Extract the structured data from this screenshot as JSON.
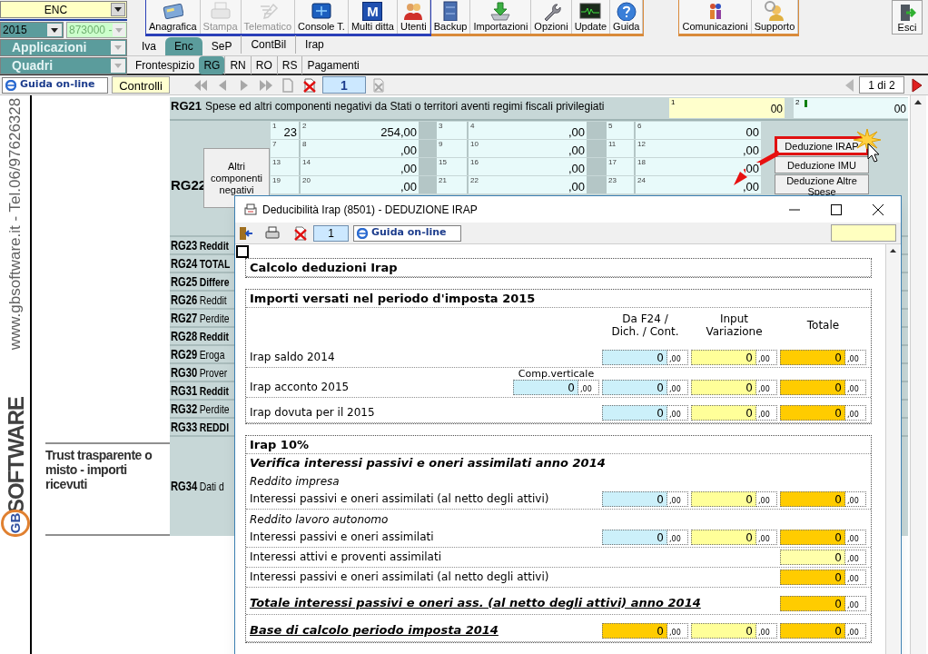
{
  "header": {
    "company": "ENC",
    "year": "2015",
    "code": "873000 -",
    "applicazioni": "Applicazioni",
    "quadri": "Quadri"
  },
  "toolbar_groups": [
    {
      "color": "#2a3fb8",
      "buttons": [
        {
          "label": "Anagrafica",
          "disabled": false
        },
        {
          "label": "Stampa",
          "disabled": true
        },
        {
          "label": "Telematico",
          "disabled": true
        },
        {
          "label": "Console T.",
          "disabled": false
        },
        {
          "label": "Multi ditta",
          "glyph": "M",
          "disabled": false
        },
        {
          "label": "Utenti",
          "disabled": false
        }
      ]
    },
    {
      "color": "#d98a3a",
      "buttons": [
        {
          "label": "Backup",
          "disabled": false
        },
        {
          "label": "Importazioni",
          "disabled": false
        },
        {
          "label": "Opzioni",
          "disabled": false
        },
        {
          "label": "Update",
          "disabled": false
        },
        {
          "label": "Guida",
          "disabled": false
        }
      ]
    },
    {
      "color": "#d98a3a",
      "buttons": [
        {
          "label": "Comunicazioni",
          "disabled": false
        },
        {
          "label": "Supporto",
          "disabled": false
        }
      ]
    }
  ],
  "exit_button": "Esci",
  "app_tabs": [
    {
      "label": "Iva",
      "selected": false
    },
    {
      "label": "Enc",
      "selected": true
    },
    {
      "label": "SeP",
      "selected": false
    },
    {
      "label": "ContBil",
      "selected": false
    },
    {
      "label": "Irap",
      "selected": false
    }
  ],
  "quadri_tabs": [
    {
      "label": "Frontespizio",
      "selected": false
    },
    {
      "label": "RG",
      "selected": true
    },
    {
      "label": "RN",
      "selected": false
    },
    {
      "label": "RO",
      "selected": false
    },
    {
      "label": "RS",
      "selected": false
    },
    {
      "label": "Pagamenti",
      "selected": false
    }
  ],
  "nav": {
    "help": "Guida on-line",
    "checks": "Controlli",
    "page": "1",
    "pages": "1 di 2"
  },
  "side": {
    "contact": "www.gbsoftware.it - Tel.06/97626328",
    "brand_mark": "GB",
    "brand": "SOFTWARE",
    "note": "Trust trasparente o misto - importi ricevuti"
  },
  "form": {
    "rg21": {
      "code": "RG21",
      "label": "Spese ed altri componenti negativi da Stati o territori aventi regimi fiscali privilegiati",
      "fields": [
        {
          "number": "1",
          "value": "00",
          "color": "#ffffcc",
          "focused": false
        },
        {
          "number": "2",
          "value": "00",
          "color": "#eafafa",
          "focused": true
        }
      ]
    },
    "rg22": {
      "code": "RG22",
      "button": "Altri componenti negativi",
      "rows": [
        {
          "cells": [
            {
              "number": "1",
              "value": "23"
            },
            {
              "number": "2",
              "value": "254,00"
            },
            {
              "number": "3"
            },
            {
              "number": "4",
              "value": ",00"
            },
            {
              "number": "5"
            },
            {
              "number": "6",
              "value": "00"
            }
          ]
        },
        {
          "cells": [
            {
              "number": "7"
            },
            {
              "number": "8",
              "value": ",00"
            },
            {
              "number": "9"
            },
            {
              "number": "10",
              "value": ",00"
            },
            {
              "number": "11"
            },
            {
              "number": "12",
              "value": ",00"
            }
          ]
        },
        {
          "cells": [
            {
              "number": "13"
            },
            {
              "number": "14",
              "value": ",00"
            },
            {
              "number": "15"
            },
            {
              "number": "16",
              "value": ",00"
            },
            {
              "number": "17"
            },
            {
              "number": "18",
              "value": "00"
            }
          ]
        },
        {
          "cells": [
            {
              "number": "19"
            },
            {
              "number": "20",
              "value": ",00"
            },
            {
              "number": "21"
            },
            {
              "number": "22",
              "value": ",00"
            },
            {
              "number": "23"
            },
            {
              "number": "24",
              "value": ",00"
            }
          ]
        }
      ]
    },
    "actions": [
      {
        "label": "Deduzione IRAP",
        "highlighted": true
      },
      {
        "label": "Deduzione IMU",
        "highlighted": false
      },
      {
        "label": "Deduzione Altre Spese",
        "highlighted": false
      }
    ],
    "lines": [
      {
        "code": "RG23",
        "label": "Reddit",
        "bold": true
      },
      {
        "code": "RG24",
        "label": "TOTAL",
        "bold": true
      },
      {
        "code": "RG25",
        "label": "Differe",
        "bold": true
      },
      {
        "code": "RG26",
        "label": "Reddit",
        "bold": false
      },
      {
        "code": "RG27",
        "label": "Perdite",
        "bold": false
      },
      {
        "code": "RG28",
        "label": "Reddit",
        "bold": true
      },
      {
        "code": "RG29",
        "label": "Eroga",
        "bold": false
      },
      {
        "code": "RG30",
        "label": "Prover",
        "bold": false
      },
      {
        "code": "RG31",
        "label": "Reddit",
        "bold": true
      },
      {
        "code": "RG32",
        "label": "Perdite",
        "bold": false
      },
      {
        "code": "RG33",
        "label": "REDDI",
        "bold": true
      }
    ],
    "rg34": {
      "code": "RG34",
      "label": "Dati d"
    }
  },
  "dialog": {
    "title": "Deducibilità Irap (8501) - DEDUZIONE IRAP",
    "page": "1",
    "help": "Guida on-line",
    "columns": [
      "Da F24 /\nDich. / Cont.",
      "Input\nVariazione",
      "Totale"
    ],
    "sections": [
      {
        "title": "Calcolo deduzioni Irap"
      },
      {
        "title": "Importi versati nel periodo d'imposta 2015",
        "show_columns": true,
        "rows": [
          {
            "kind": "values",
            "label": "Irap saldo 2014",
            "f24": {
              "value": "0",
              "decimals": ",00",
              "color": "#ccf0fa"
            },
            "variazione": {
              "value": "0",
              "decimals": ",00",
              "color": "#ffff99"
            },
            "totale": {
              "value": "0",
              "decimals": ",00",
              "color": "#ffcc00"
            }
          },
          {
            "kind": "values",
            "label": "Irap acconto 2015",
            "extra": {
              "label": "Comp.verticale",
              "value": "0",
              "decimals": ",00",
              "color": "#ccf0fa"
            },
            "f24": {
              "value": "0",
              "decimals": ",00",
              "color": "#ccf0fa"
            },
            "variazione": {
              "value": "0",
              "decimals": ",00",
              "color": "#ffff99"
            },
            "totale": {
              "value": "0",
              "decimals": ",00",
              "color": "#ffcc00"
            }
          },
          {
            "kind": "values",
            "label": "Irap dovuta per il 2015",
            "f24": {
              "value": "0",
              "decimals": ",00",
              "color": "#ccf0fa"
            },
            "variazione": {
              "value": "0",
              "decimals": ",00",
              "color": "#ffff99"
            },
            "totale": {
              "value": "0",
              "decimals": ",00",
              "color": "#ffcc00"
            }
          }
        ]
      },
      {
        "title": "Irap 10%",
        "rows": [
          {
            "kind": "heading",
            "label": "Verifica interessi passivi e oneri assimilati anno 2014"
          },
          {
            "kind": "note",
            "label": "Reddito impresa"
          },
          {
            "kind": "values",
            "label": "Interessi passivi e oneri assimilati (al netto degli attivi)",
            "f24": {
              "value": "0",
              "decimals": ",00",
              "color": "#ccf0fa"
            },
            "variazione": {
              "value": "0",
              "decimals": ",00",
              "color": "#ffff99"
            },
            "totale": {
              "value": "0",
              "decimals": ",00",
              "color": "#ffcc00"
            }
          },
          {
            "kind": "note",
            "label": "Reddito lavoro autonomo"
          },
          {
            "kind": "values",
            "label": "Interessi passivi e oneri assimilati",
            "f24": {
              "value": "0",
              "decimals": ",00",
              "color": "#ccf0fa"
            },
            "variazione": {
              "value": "0",
              "decimals": ",00",
              "color": "#ffff99"
            },
            "totale": {
              "value": "0",
              "decimals": ",00",
              "color": "#ffcc00"
            }
          },
          {
            "kind": "values",
            "label": "Interessi attivi e proventi assimilati",
            "totale": {
              "value": "0",
              "decimals": ",00",
              "color": "#ffffaa"
            }
          },
          {
            "kind": "values",
            "label": "Interessi passivi e oneri assimilati (al netto degli attivi)",
            "totale": {
              "value": "0",
              "decimals": ",00",
              "color": "#ffcc00"
            }
          },
          {
            "kind": "total",
            "label": "Totale interessi passivi e oneri ass. (al netto degli attivi) anno 2014",
            "totale": {
              "value": "0",
              "decimals": ",00",
              "color": "#ffcc00"
            }
          },
          {
            "kind": "total",
            "label": "Base di calcolo periodo imposta 2014",
            "f24": {
              "value": "0",
              "decimals": ",00",
              "color": "#ffcc00"
            },
            "variazione": {
              "value": "0",
              "decimals": ",00",
              "color": "#ffff99"
            },
            "totale": {
              "value": "0",
              "decimals": ",00",
              "color": "#ffcc00"
            }
          }
        ]
      }
    ]
  }
}
